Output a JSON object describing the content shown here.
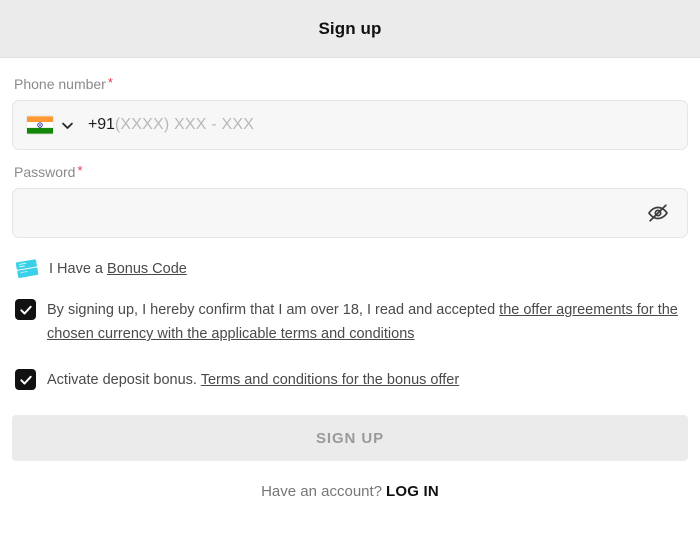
{
  "header": {
    "title": "Sign up"
  },
  "colors": {
    "header_bg": "#ebebeb",
    "input_bg": "#f7f7f7",
    "required_asterisk": "#e23b4e",
    "ticket_icon": "#3ad0e8",
    "checkbox_checked": "#111111",
    "submit_bg": "#ebebeb",
    "submit_text": "#9a9a9a",
    "flag_saffron": "#ff9933",
    "flag_white": "#ffffff",
    "flag_green": "#138808",
    "flag_chakra": "#000088"
  },
  "phone_field": {
    "label": "Phone number",
    "required_mark": "*",
    "flag_icon": "india-flag-icon",
    "dropdown_icon": "chevron-down-icon",
    "dial_code": "+91",
    "placeholder": "(XXXX) XXX - XXX",
    "value": ""
  },
  "password_field": {
    "label": "Password",
    "required_mark": "*",
    "placeholder": "",
    "value": "",
    "toggle_icon": "eye-off-icon"
  },
  "bonus_code": {
    "icon": "ticket-icon",
    "text": "I Have a",
    "link_label": "Bonus Code"
  },
  "terms_checkbox": {
    "checked": true,
    "icon": "check-icon",
    "text": "By signing up, I hereby confirm that I am over 18, I read and accepted",
    "link_label": "the offer agreements for the chosen currency with the applicable terms and conditions"
  },
  "bonus_checkbox": {
    "checked": true,
    "icon": "check-icon",
    "text": "Activate deposit bonus.",
    "link_label": "Terms and conditions for the bonus offer"
  },
  "submit": {
    "label": "SIGN UP",
    "disabled": true
  },
  "footer": {
    "text": "Have an account?",
    "link_label": "LOG IN"
  }
}
